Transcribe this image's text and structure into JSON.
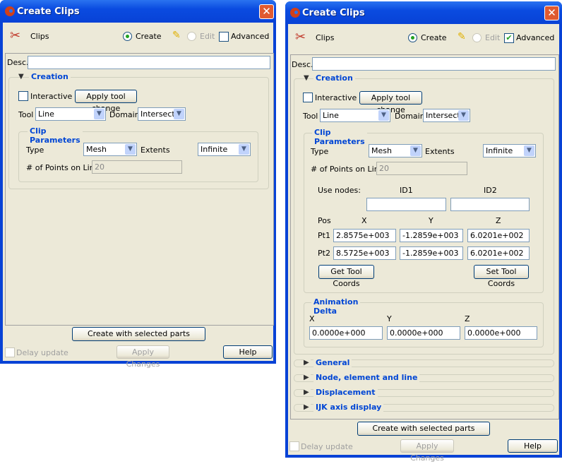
{
  "window_title": "Create Clips",
  "close_glyph": "✕",
  "header": {
    "label": "Clips",
    "create": "Create",
    "edit": "Edit",
    "advanced": "Advanced"
  },
  "desc_label": "Desc.",
  "creation": {
    "title": "Creation",
    "interactive": "Interactive",
    "apply_tool_change": "Apply tool change",
    "tool_label": "Tool",
    "tool_value": "Line",
    "domain_label": "Domain",
    "domain_value": "Intersect"
  },
  "clip_params": {
    "title": "Clip Parameters",
    "type_label": "Type",
    "type_value": "Mesh",
    "extents_label": "Extents",
    "extents_value": "Infinite",
    "points_label": "# of Points on Line",
    "points_value": "20"
  },
  "use_nodes": {
    "label": "Use nodes:",
    "id1": "ID1",
    "id2": "ID2"
  },
  "pos": {
    "label": "Pos",
    "x": "X",
    "y": "Y",
    "z": "Z",
    "pt1": {
      "label": "Pt1",
      "x": "2.8575e+003",
      "y": "-1.2859e+003",
      "z": "6.0201e+002"
    },
    "pt2": {
      "label": "Pt2",
      "x": "8.5725e+003",
      "y": "-1.2859e+003",
      "z": "6.0201e+002"
    },
    "get": "Get Tool Coords",
    "set": "Set Tool Coords"
  },
  "animation": {
    "title": "Animation Delta",
    "x_label": "X",
    "y_label": "Y",
    "z_label": "Z",
    "x": "0.0000e+000",
    "y": "0.0000e+000",
    "z": "0.0000e+000"
  },
  "sections": [
    "General",
    "Node, element and line",
    "Displacement",
    "IJK axis display"
  ],
  "footer": {
    "create": "Create with selected parts",
    "delay": "Delay update",
    "apply": "Apply Changes",
    "help": "Help"
  },
  "advanced_checked": {
    "left": false,
    "right": true
  }
}
